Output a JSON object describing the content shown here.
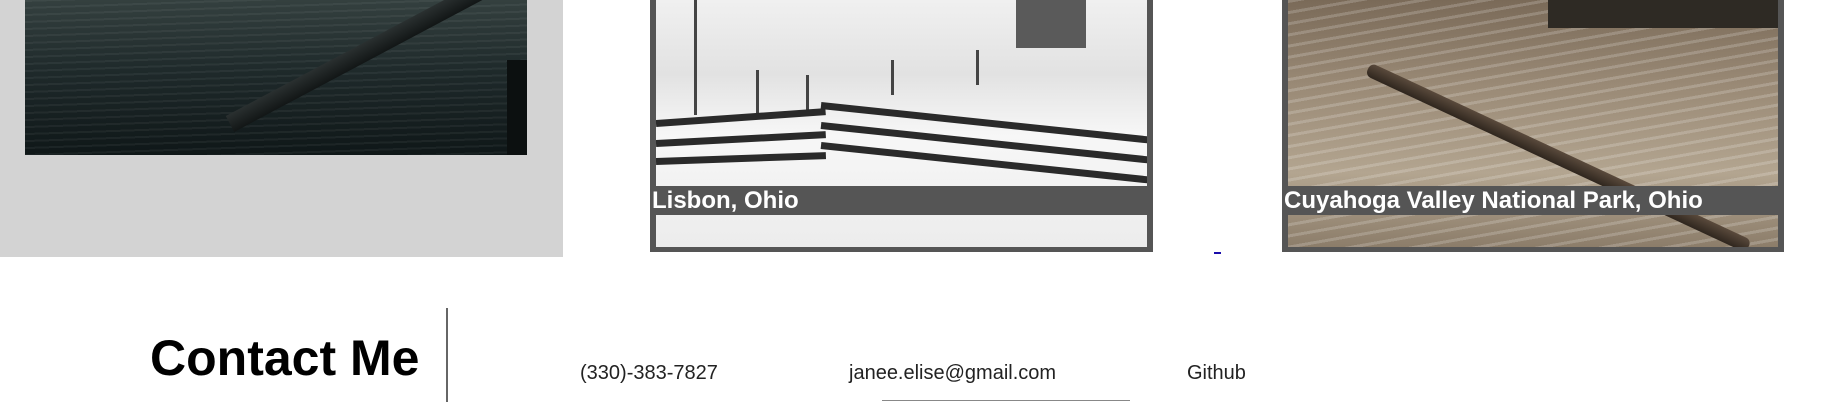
{
  "gallery": {
    "photos": [
      {
        "caption": ""
      },
      {
        "caption": "Lisbon, Ohio"
      },
      {
        "caption": "Cuyahoga Valley National Park, Ohio"
      }
    ]
  },
  "contact": {
    "title": "Contact Me",
    "phone": "(330)-383-7827",
    "email": "janee.elise@gmail.com",
    "github": "Github"
  },
  "colors": {
    "panel_bg": "#d3d3d3",
    "frame": "#555555",
    "caption_text": "#ffffff",
    "divider": "#666666"
  }
}
